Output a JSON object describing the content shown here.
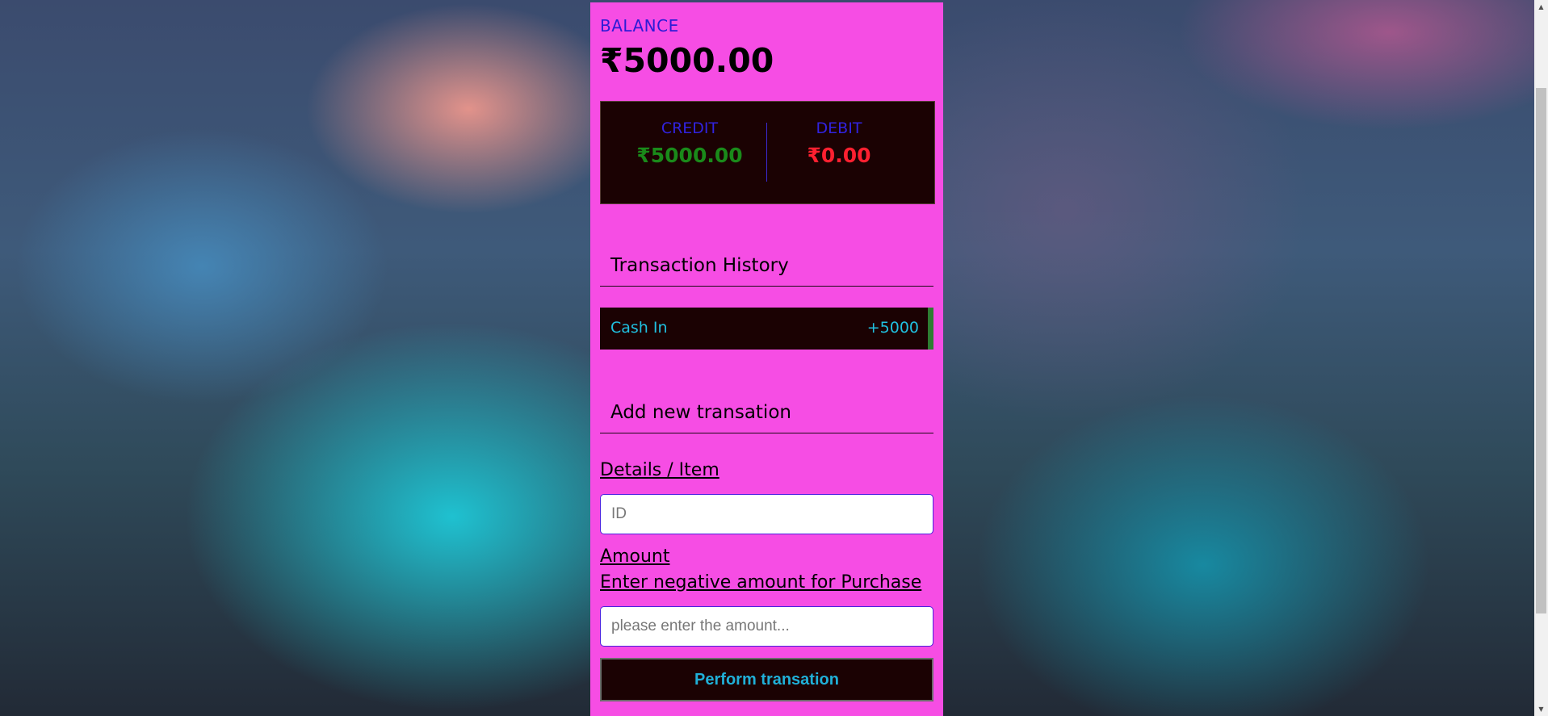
{
  "balance": {
    "label": "BALANCE",
    "amount": "₹5000.00"
  },
  "summary": {
    "credit_label": "CREDIT",
    "credit_amount": "₹5000.00",
    "debit_label": "DEBIT",
    "debit_amount": "₹0.00"
  },
  "history": {
    "title": "Transaction History",
    "items": [
      {
        "text": "Cash In",
        "amount": "+5000",
        "indicator_color": "#2e7d32"
      }
    ]
  },
  "add_form": {
    "title": "Add new transation",
    "details_label": "Details / Item",
    "details_placeholder": "ID",
    "amount_label": "Amount",
    "amount_hint": "Enter negative amount for Purchase",
    "amount_placeholder": "please enter the amount...",
    "submit_label": "Perform transation"
  },
  "colors": {
    "panel": "#f64de4",
    "dark_box": "#1b0203",
    "credit": "#1a8a1a",
    "debit": "#ff2030",
    "label_blue": "#2d1bd6",
    "accent_cyan": "#20c0e0"
  }
}
